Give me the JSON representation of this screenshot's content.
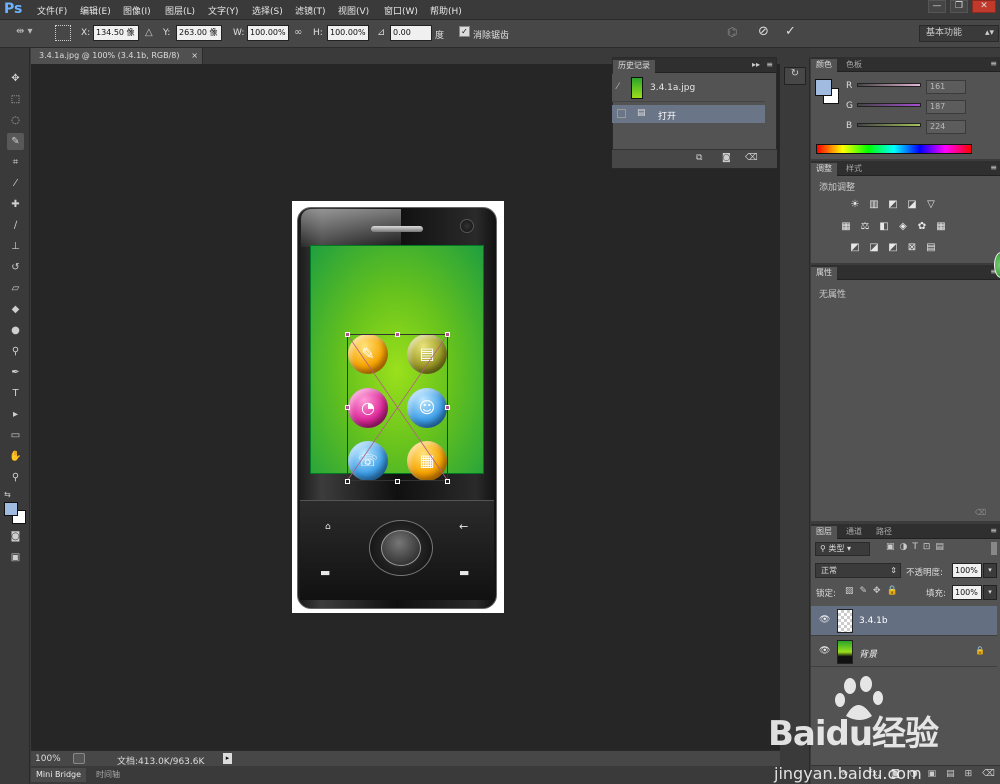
{
  "app": {
    "logo": "Ps"
  },
  "menu": [
    "文件(F)",
    "编辑(E)",
    "图像(I)",
    "图层(L)",
    "文字(Y)",
    "选择(S)",
    "滤镜(T)",
    "视图(V)",
    "窗口(W)",
    "帮助(H)"
  ],
  "window_controls": {
    "minimize": "—",
    "restore": "❐",
    "close": "✕"
  },
  "options": {
    "x_label": "X:",
    "x_value": "134.50 像",
    "y_label": "Y:",
    "y_value": "263.00 像",
    "w_label": "W:",
    "w_value": "100.00%",
    "h_label": "H:",
    "h_value": "100.00%",
    "angle_value": "0.00",
    "angle_unit": "度",
    "antialias_label": "消除锯齿",
    "antialias_checked": true,
    "workspace": "基本功能"
  },
  "document": {
    "tab_title": "3.4.1a.jpg @ 100% (3.4.1b, RGB/8)",
    "tab_close": "×"
  },
  "history": {
    "tabs": [
      "历史记录"
    ],
    "snapshot_name": "3.4.1a.jpg",
    "items": [
      {
        "label": "打开"
      }
    ]
  },
  "color_panel": {
    "tabs": [
      "颜色",
      "色板"
    ],
    "channels": [
      {
        "label": "R",
        "value": "161",
        "track": "#e8b7d7"
      },
      {
        "label": "G",
        "value": "187",
        "track": "#a64fd3"
      },
      {
        "label": "B",
        "value": "224",
        "track": "#a5c35c"
      }
    ],
    "foreground": "#a1bbe0",
    "background": "#ffffff"
  },
  "adjustments": {
    "tabs": [
      "调整",
      "样式"
    ],
    "heading": "添加调整",
    "row1": [
      "☀",
      "▥",
      "◩",
      "◪",
      "▽"
    ],
    "row2": [
      "▦",
      "⚖",
      "◧",
      "◈",
      "✿",
      "▦"
    ],
    "row3": [
      "◩",
      "◪",
      "◩",
      "⊠",
      "▤"
    ]
  },
  "properties": {
    "tabs": [
      "属性"
    ],
    "empty_text": "无属性"
  },
  "layers": {
    "tabs": [
      "图层",
      "通道",
      "路径"
    ],
    "filter_kind": "类型",
    "blend_mode": "正常",
    "opacity_label": "不透明度:",
    "opacity_value": "100%",
    "lock_label": "锁定:",
    "fill_label": "填充:",
    "fill_value": "100%",
    "items": [
      {
        "name": "3.4.1b",
        "visible": true,
        "selected": true
      },
      {
        "name": "背景",
        "visible": true,
        "locked": true
      }
    ],
    "footer_fx": "fx."
  },
  "status": {
    "zoom": "100%",
    "doc_info": "文档:413.0K/963.6K"
  },
  "bottom_tabs": [
    "Mini Bridge",
    "时间轴"
  ],
  "watermark": {
    "brand": "Baidu经验",
    "url": "jingyan.baidu.com"
  }
}
